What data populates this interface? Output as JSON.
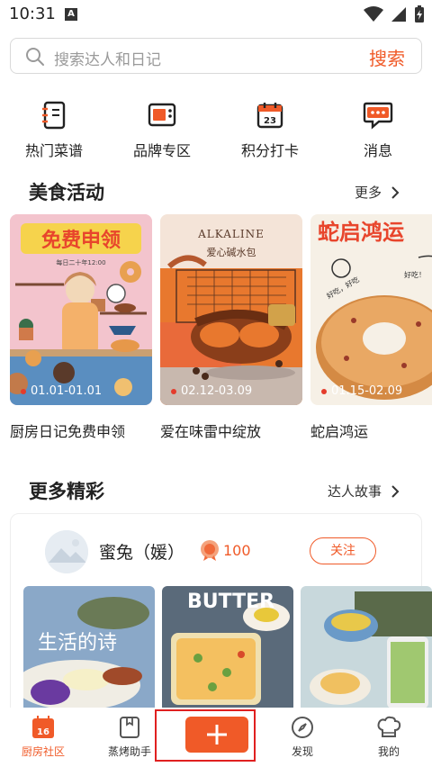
{
  "status_bar": {
    "time": "10:31",
    "notif_letter": "A"
  },
  "search": {
    "placeholder": "搜索达人和日记",
    "button": "搜索"
  },
  "quick_links": [
    {
      "label": "热门菜谱",
      "icon": "recipe-book-icon"
    },
    {
      "label": "品牌专区",
      "icon": "oven-icon"
    },
    {
      "label": "积分打卡",
      "icon": "calendar-icon"
    },
    {
      "label": "消息",
      "icon": "message-icon"
    }
  ],
  "food_events": {
    "title": "美食活动",
    "more": "更多",
    "items": [
      {
        "date": "01.01-01.01",
        "title": "厨房日记免费申领",
        "banner": "免费申领"
      },
      {
        "date": "02.12-03.09",
        "title": "爱在味雷中绽放",
        "banner": "ALKALINE",
        "banner_sub": "爱心碱水包"
      },
      {
        "date": "01.15-02.09",
        "title": "蛇启鸿运",
        "banner": "蛇启鸿运"
      }
    ]
  },
  "more_section": {
    "title": "更多精彩",
    "more": "达人故事",
    "user": {
      "name": "蜜兔（媛）",
      "points": "100",
      "follow": "关注"
    },
    "photos": [
      {
        "caption": "生活的诗"
      },
      {
        "caption": "BUTTER"
      },
      {
        "caption": ""
      }
    ]
  },
  "tab_bar": {
    "items": [
      {
        "label": "厨房社区",
        "active": true,
        "calendar_num": "16"
      },
      {
        "label": "蒸烤助手",
        "active": false
      },
      {
        "label": "",
        "active": false
      },
      {
        "label": "发现",
        "active": false
      },
      {
        "label": "我的",
        "active": false
      }
    ]
  },
  "colors": {
    "accent": "#f05a28",
    "highlight_border": "#e02020"
  }
}
